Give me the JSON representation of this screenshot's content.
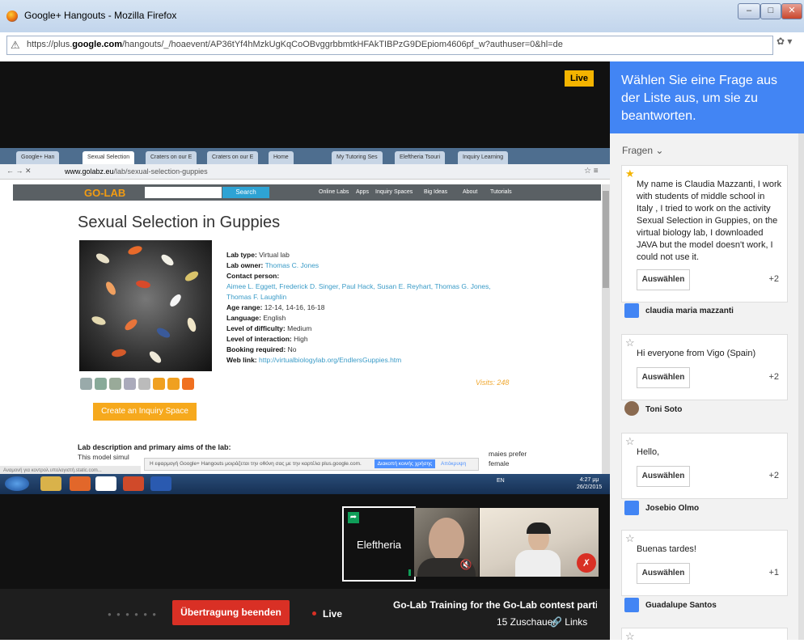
{
  "window": {
    "title": "Google+ Hangouts - Mozilla Firefox",
    "url_prefix": "https://plus.",
    "url_domain": "google.com",
    "url_rest": "/hangouts/_/hoaevent/AP36tYf4hMzkUgKqCoOBvggrbbmtkHFAkTIBPzG9DEpiom4606pf_w?authuser=0&hl=de"
  },
  "stage": {
    "live_badge": "Live"
  },
  "share": {
    "tabs": [
      "Google+ Han",
      "Sexual Selection",
      "Craters on our E",
      "Craters on our E",
      "Home",
      "My Tutoring Ses",
      "Eleftheria Tsouri",
      "Inquiry Learning"
    ],
    "url_domain": "www.golabz.eu",
    "url_path": "/lab/sexual-selection-guppies",
    "logo": "GO-LAB",
    "search_btn": "Search",
    "nav": [
      "Online Labs",
      "Apps",
      "Inquiry Spaces",
      "Big Ideas",
      "About",
      "Tutorials"
    ],
    "page_title": "Sexual Selection in Guppies",
    "lab_type_label": "Lab type:",
    "lab_type": "Virtual lab",
    "lab_owner_label": "Lab owner:",
    "lab_owner": "Thomas C. Jones",
    "contact_label": "Contact person:",
    "contact1": "Aimee L. Eggett, Frederick D. Singer, Paul Hack, Susan E. Reyhart, Thomas G. Jones,",
    "contact2": "Thomas F. Laughlin",
    "age_label": "Age range:",
    "age": "12-14, 14-16, 16-18",
    "language_label": "Language:",
    "language": "English",
    "difficulty_label": "Level of difficulty:",
    "difficulty": "Medium",
    "interaction_label": "Level of interaction:",
    "interaction": "High",
    "booking_label": "Booking required:",
    "booking": "No",
    "weblink_label": "Web link:",
    "weblink": "http://virtualbiologylab.org/EndlersGuppies.htm",
    "visits": "Visits: 248",
    "inquiry_btn": "Create an Inquiry Space",
    "desc_title": "Lab description and primary aims of the lab:",
    "desc_line": "This model simul",
    "desc_right1": "maies prefer",
    "desc_right2": "female",
    "notif_text": "Η εφαρμογή Google+ Hangouts μοιράζεται την οθόνη σας με την καρτέλα plus.google.com.",
    "notif_btn": "Διακοπή κοινής χρήσης",
    "notif_hide": "Απόκρυψη",
    "status_text": "Αναμονή για κοντρολ.υπολογιστή.static.com...",
    "tray_lang": "EN",
    "clock_time": "4:27 μμ",
    "clock_date": "26/2/2015"
  },
  "participants": {
    "presenter_name": "Eleftheria"
  },
  "bottom": {
    "dots": "● ● ● ● ● ●",
    "end_btn": "Übertragung beenden",
    "live": "Live",
    "broadcast_title": "Go-Lab Training for the Go-Lab contest partic...",
    "viewers": "15 Zuschauer",
    "links": "Links"
  },
  "qa": {
    "header": "Wählen Sie eine Frage aus der Liste aus, um sie zu beantworten.",
    "filter": "Fragen",
    "select_label": "Auswählen",
    "questions": [
      {
        "text": "My name is Claudia Mazzanti, I work with students of middle school in Italy , I tried to work on the activity Sexual Selection in Guppies, on the virtual biology lab, I downloaded JAVA but the model doesn't work, I could not use it.",
        "votes": "+2",
        "author": "claudia maria mazzanti",
        "starred": true
      },
      {
        "text": "Hi everyone from Vigo (Spain)",
        "votes": "+2",
        "author": "Toni Soto",
        "starred": false
      },
      {
        "text": "Hello,",
        "votes": "+2",
        "author": "Josebio Olmo",
        "starred": false
      },
      {
        "text": "Buenas tardes!",
        "votes": "+1",
        "author": "Guadalupe Santos",
        "starred": false
      }
    ]
  },
  "colors": {
    "accent_blue": "#4285f4",
    "live_yellow": "#f4b400",
    "end_red": "#d93025",
    "golab_orange": "#f39c12"
  }
}
